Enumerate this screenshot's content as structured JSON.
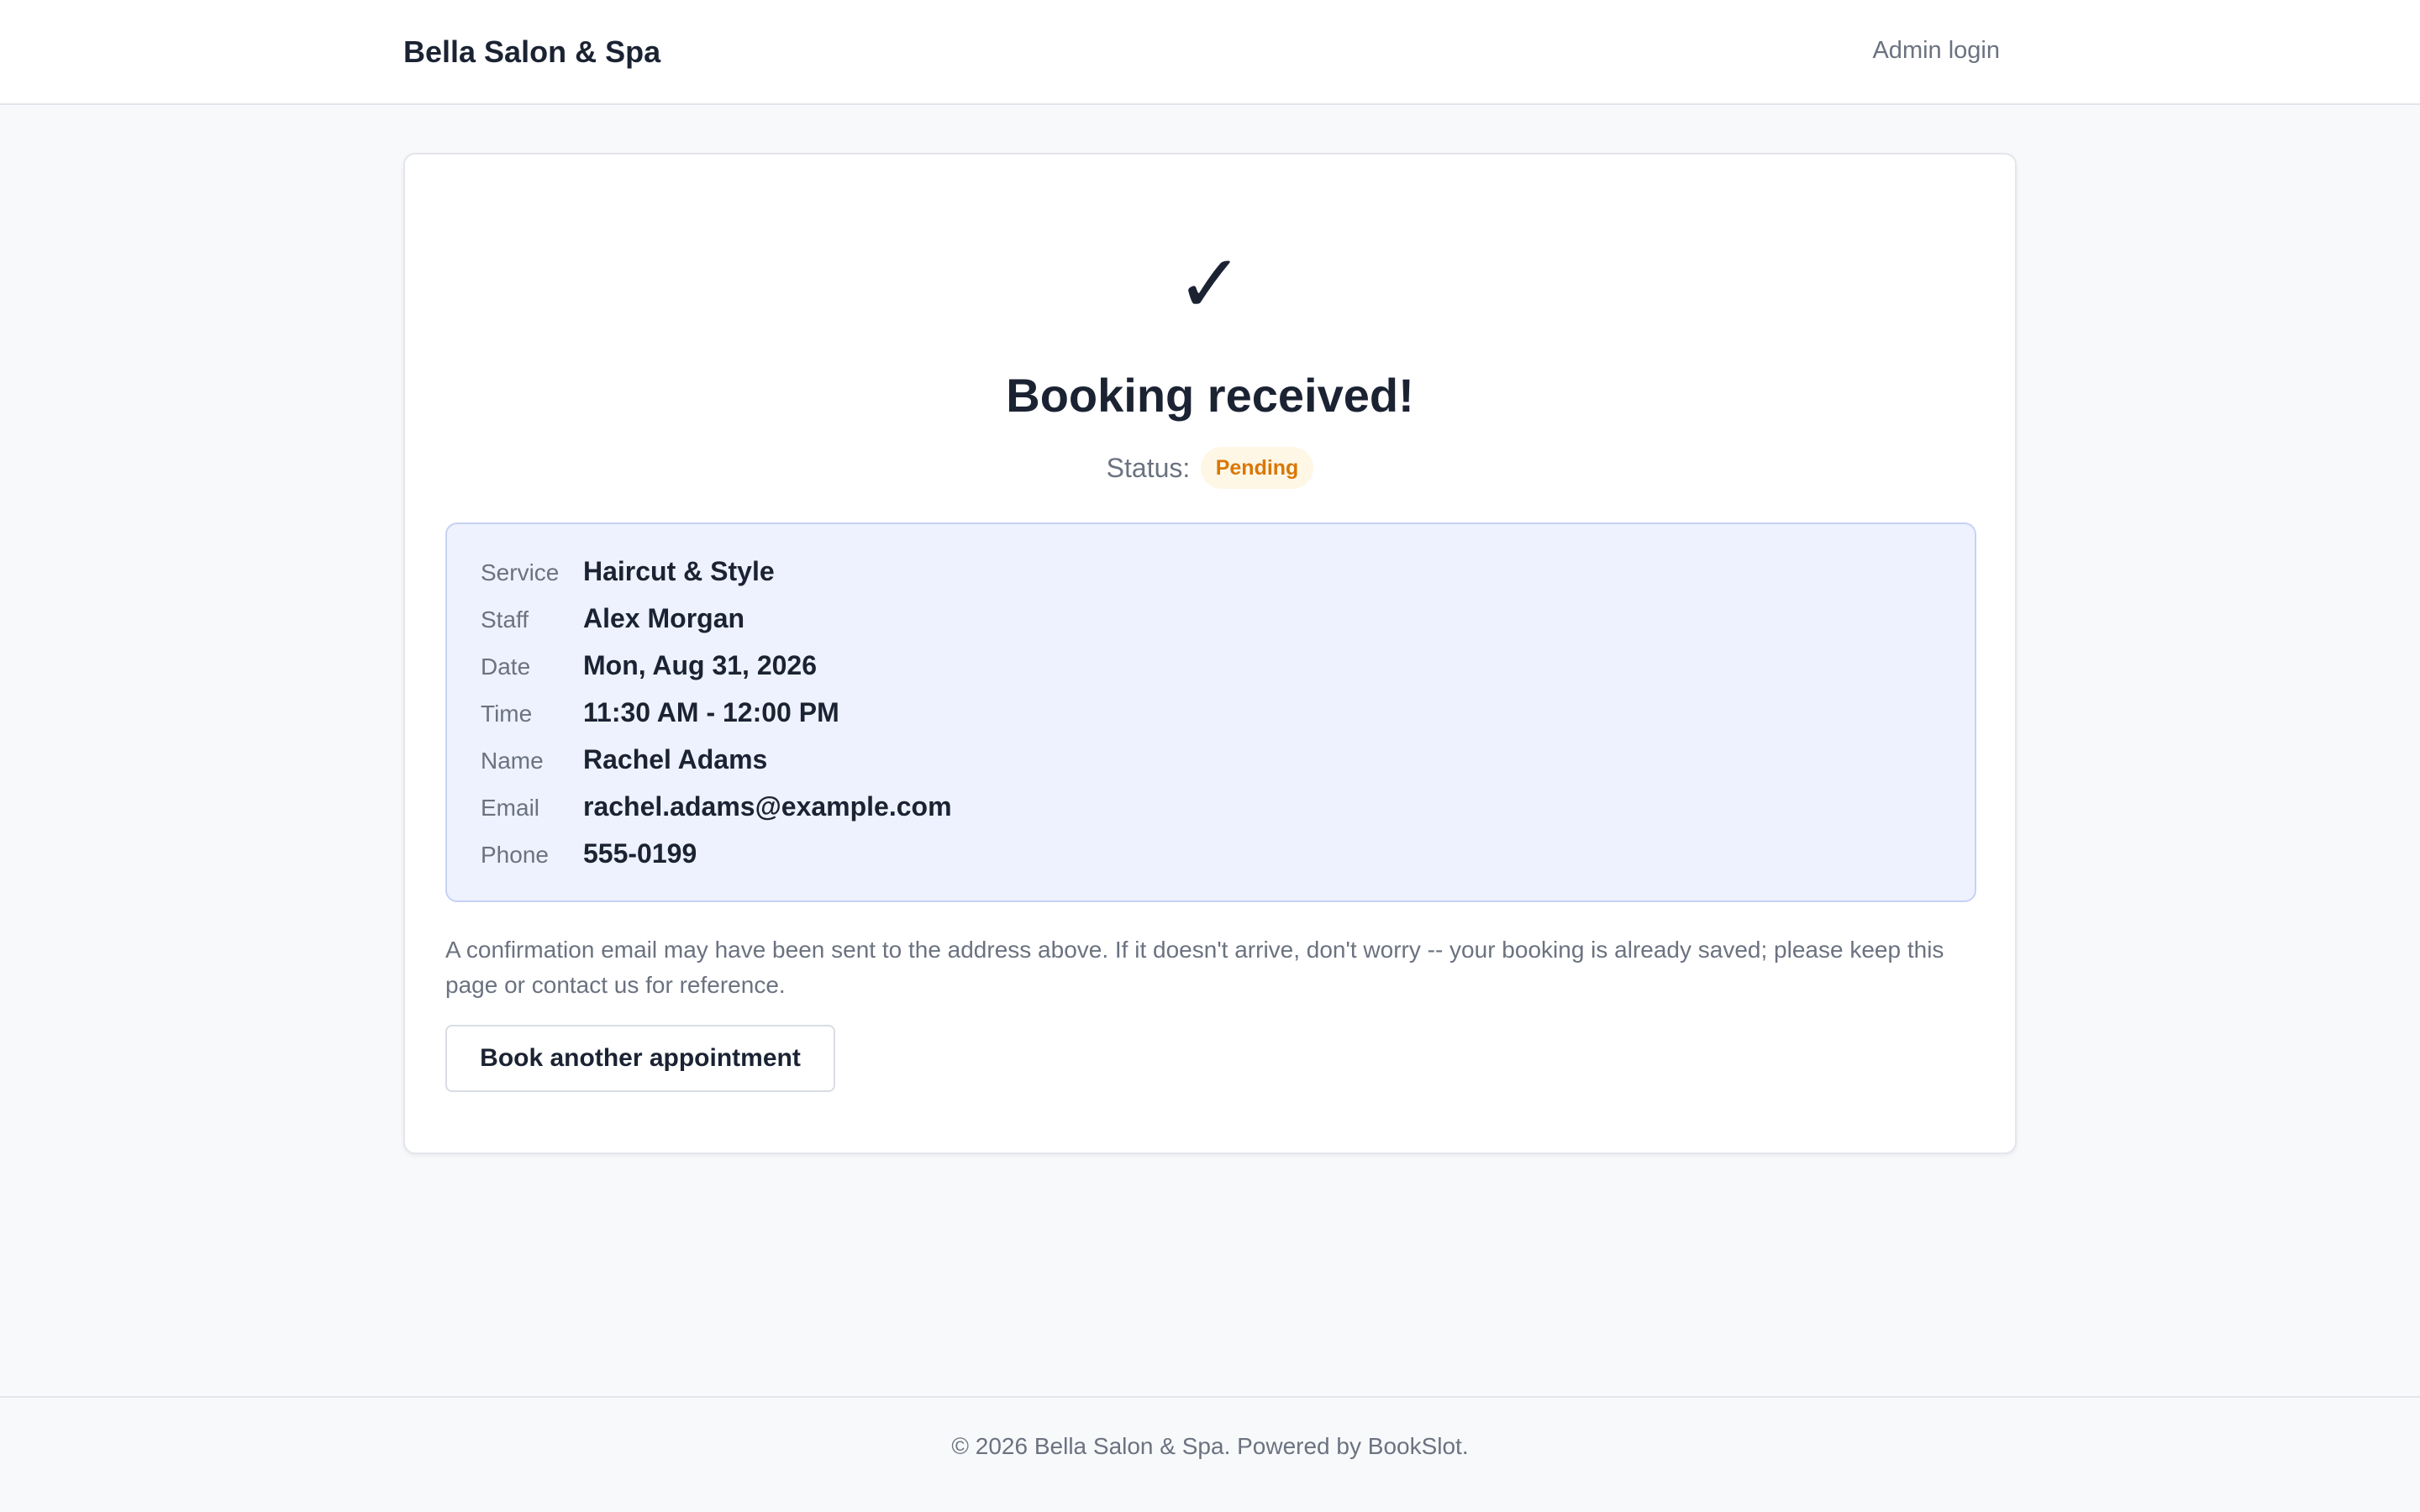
{
  "header": {
    "brand": "Bella Salon & Spa",
    "admin_link": "Admin login"
  },
  "confirmation": {
    "icon": "checkmark-icon",
    "icon_glyph": "✓",
    "title": "Booking received!",
    "status_label": "Status:",
    "status_value": "Pending",
    "status_color": "#d97706"
  },
  "details": [
    {
      "label": "Service",
      "value": "Haircut & Style"
    },
    {
      "label": "Staff",
      "value": "Alex Morgan"
    },
    {
      "label": "Date",
      "value": "Mon, Aug 31, 2026"
    },
    {
      "label": "Time",
      "value": "11:30 AM - 12:00 PM"
    },
    {
      "label": "Name",
      "value": "Rachel Adams"
    },
    {
      "label": "Email",
      "value": "rachel.adams@example.com"
    },
    {
      "label": "Phone",
      "value": "555-0199"
    }
  ],
  "note": "A confirmation email may have been sent to the address above. If it doesn't arrive, don't worry -- your booking is already saved; please keep this page or contact us for reference.",
  "actions": {
    "book_another_label": "Book another appointment"
  },
  "footer": {
    "text": "© 2026 Bella Salon & Spa. Powered by BookSlot."
  }
}
